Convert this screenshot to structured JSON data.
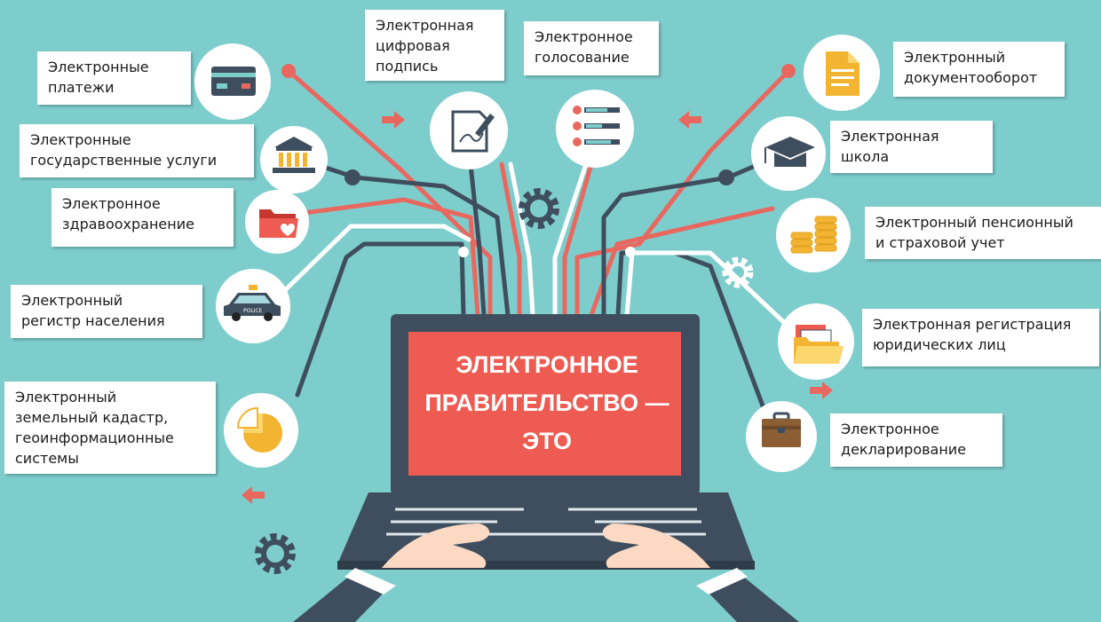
{
  "center": {
    "title": "ЭЛЕКТРОННОЕ\nПРАВИТЕЛЬСТВО —\nЭТО"
  },
  "services": [
    {
      "id": "payments",
      "label": "Электронные\nплатежи",
      "icon": "payment-card-icon"
    },
    {
      "id": "state-services",
      "label": "Электронные\nгосударственные услуги",
      "icon": "government-building-icon"
    },
    {
      "id": "healthcare",
      "label": "Электронное\nздравоохранение",
      "icon": "medical-folder-icon"
    },
    {
      "id": "population-register",
      "label": "Электронный\nрегистр населения",
      "icon": "police-car-icon"
    },
    {
      "id": "land-cadastre",
      "label": "Электронный\nземельный кадастр,\nгеоинформационные\nсистемы",
      "icon": "pie-chart-icon"
    },
    {
      "id": "digital-signature",
      "label": "Электронная\nцифровая\nподпись",
      "icon": "signature-document-icon"
    },
    {
      "id": "voting",
      "label": "Электронное\nголосование",
      "icon": "voting-list-icon"
    },
    {
      "id": "document-flow",
      "label": "Электронный\nдокументооборот",
      "icon": "document-icon"
    },
    {
      "id": "school",
      "label": "Электронная\nшкола",
      "icon": "graduation-cap-icon"
    },
    {
      "id": "pension",
      "label": "Электронный пенсионный\nи страховой учет",
      "icon": "coins-icon"
    },
    {
      "id": "legal-registration",
      "label": "Электронная регистрация\nюридических лиц",
      "icon": "folders-icon"
    },
    {
      "id": "declaration",
      "label": "Электронное\nдекларирование",
      "icon": "briefcase-icon"
    }
  ],
  "colors": {
    "background": "#7ecdcd",
    "screen": "#ed5b52",
    "laptop": "#3f4e5e",
    "line-red": "#e8685f",
    "line-dark": "#3f4e5e",
    "line-white": "#ffffff",
    "label-bg": "#ffffff"
  }
}
